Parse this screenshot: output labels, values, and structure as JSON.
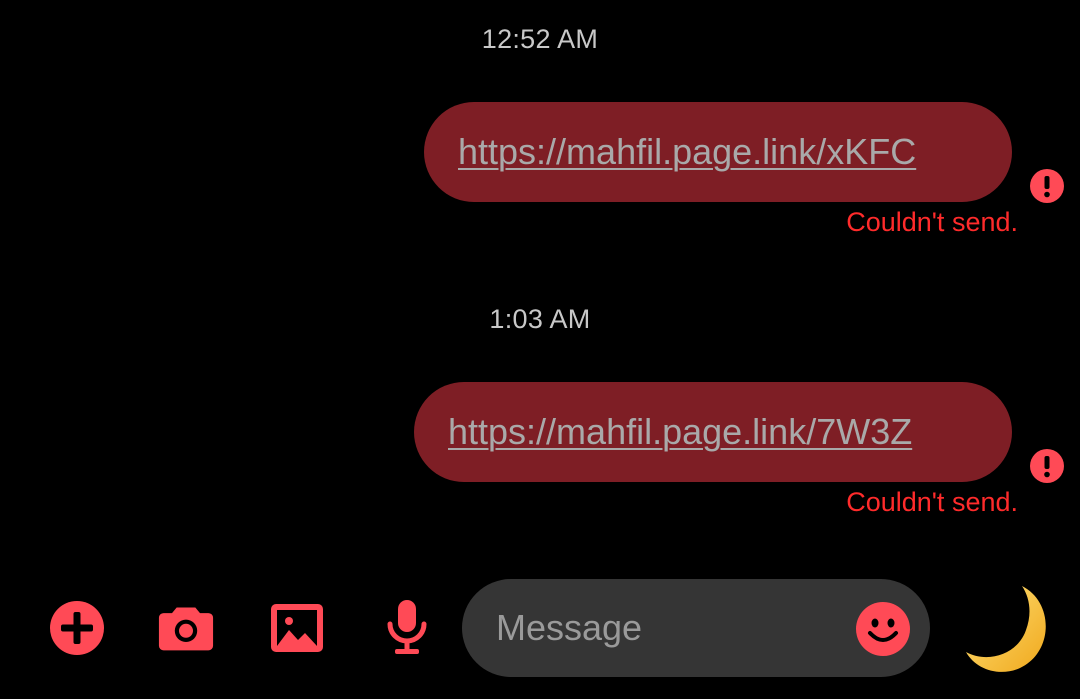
{
  "colors": {
    "background": "#000000",
    "bubble": "#7e1e25",
    "link_text": "#a9a9a9",
    "error": "#ff2b2b",
    "icon_accent": "#ff4a56",
    "composer": "#353535"
  },
  "messages": [
    {
      "timestamp": "12:52 AM",
      "text": "https://mahfil.page.link/xKFC",
      "status": "Couldn't send.",
      "status_icon": "error-exclamation-icon"
    },
    {
      "timestamp": "1:03 AM",
      "text": "https://mahfil.page.link/7W3Z",
      "status": "Couldn't send.",
      "status_icon": "error-exclamation-icon"
    }
  ],
  "toolbar": {
    "icons": [
      "add-icon",
      "camera-icon",
      "gallery-icon",
      "microphone-icon"
    ]
  },
  "composer": {
    "placeholder": "Message",
    "value": "",
    "emoji_icon": "emoji-smiley-icon",
    "send_icon": "crescent-moon-icon"
  }
}
